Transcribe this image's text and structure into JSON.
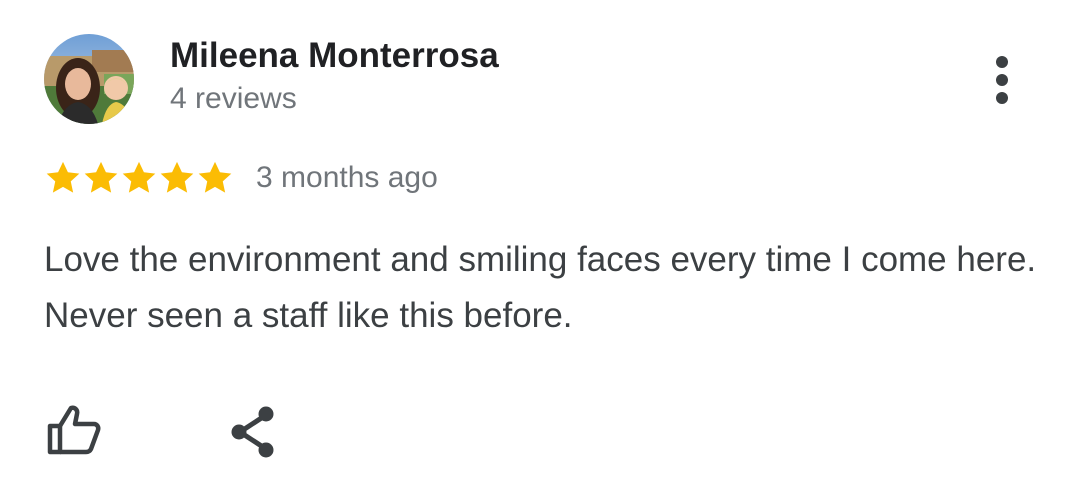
{
  "review": {
    "author_name": "Mileena Monterrosa",
    "review_count": "4 reviews",
    "rating": 5,
    "rating_max": 5,
    "time_ago": "3 months ago",
    "text": "Love the environment and smiling faces every time I come here. Never seen a staff like this before."
  },
  "icons": {
    "more": "more-vert-icon",
    "star": "star-icon",
    "like": "thumbs-up-icon",
    "share": "share-icon"
  },
  "colors": {
    "star": "#fbbc04",
    "name": "#202124",
    "secondary": "#70757a",
    "body": "#3c4043",
    "icon": "#3c4043"
  }
}
